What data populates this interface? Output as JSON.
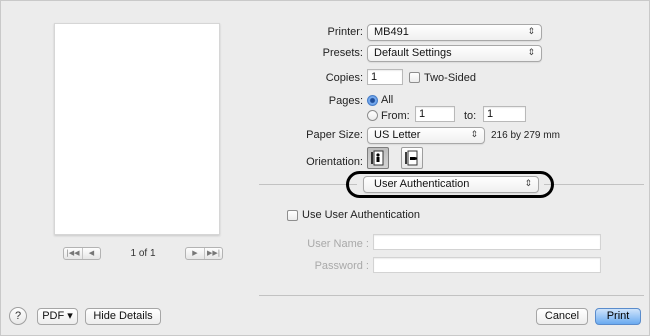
{
  "preview": {
    "page_count": "1 of 1",
    "nav": {
      "first": "|◀◀",
      "prev": "◀",
      "next": "▶",
      "last": "▶▶|"
    }
  },
  "printer": {
    "label": "Printer:",
    "value": "MB491"
  },
  "presets": {
    "label": "Presets:",
    "value": "Default Settings"
  },
  "copies": {
    "label": "Copies:",
    "value": "1",
    "two_sided_label": "Two-Sided",
    "two_sided_checked": false
  },
  "pages": {
    "label": "Pages:",
    "all_label": "All",
    "from_label": "From:",
    "from_value": "1",
    "to_label": "to:",
    "to_value": "1"
  },
  "paper_size": {
    "label": "Paper Size:",
    "value": "US Letter",
    "dimensions": "216 by 279 mm"
  },
  "orientation": {
    "label": "Orientation:"
  },
  "panel_selector": {
    "value": "User Authentication"
  },
  "auth": {
    "use_auth_label": "Use User Authentication",
    "use_auth_checked": false,
    "user_name_label": "User Name :",
    "password_label": "Password :",
    "user_name_value": "",
    "password_value": ""
  },
  "footer": {
    "help": "?",
    "pdf_label": "PDF ▾",
    "hide_details_label": "Hide Details",
    "cancel_label": "Cancel",
    "print_label": "Print"
  },
  "icons": {
    "popup_arrows": "updown-arrows-icon",
    "portrait": "portrait-orientation-icon",
    "landscape": "landscape-orientation-icon",
    "help": "help-icon"
  },
  "colors": {
    "accent": "#4b8be0",
    "dialog_bg": "#ececec",
    "highlight_ring": "#000000"
  }
}
